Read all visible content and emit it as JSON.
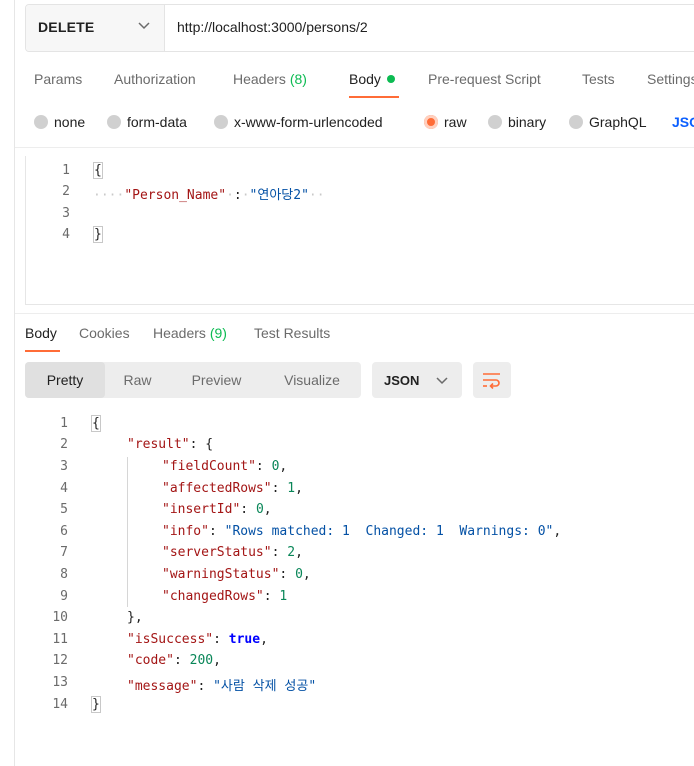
{
  "request": {
    "method": "DELETE",
    "url": "http://localhost:3000/persons/2"
  },
  "request_tabs": [
    {
      "label": "Params"
    },
    {
      "label": "Authorization"
    },
    {
      "label": "Headers",
      "count": "(8)"
    },
    {
      "label": "Body",
      "active": true
    },
    {
      "label": "Pre-request Script"
    },
    {
      "label": "Tests"
    },
    {
      "label": "Settings"
    }
  ],
  "body_types": [
    {
      "label": "none"
    },
    {
      "label": "form-data"
    },
    {
      "label": "x-www-form-urlencoded"
    },
    {
      "label": "raw",
      "selected": true
    },
    {
      "label": "binary"
    },
    {
      "label": "GraphQL"
    }
  ],
  "body_format": "JSON",
  "request_body": {
    "line_numbers": [
      "1",
      "2",
      "3",
      "4"
    ],
    "open_brace": "{",
    "key": "\"Person_Name\"",
    "colon": ":",
    "value": "\"연아당2\"",
    "close_brace": "}"
  },
  "response_tabs": [
    {
      "label": "Body",
      "active": true
    },
    {
      "label": "Cookies"
    },
    {
      "label": "Headers",
      "count": "(9)"
    },
    {
      "label": "Test Results"
    }
  ],
  "view_modes": [
    "Pretty",
    "Raw",
    "Preview",
    "Visualize"
  ],
  "response_format": "JSON",
  "response_body": {
    "line_numbers": [
      "1",
      "2",
      "3",
      "4",
      "5",
      "6",
      "7",
      "8",
      "9",
      "10",
      "11",
      "12",
      "13",
      "14"
    ],
    "open_brace": "{",
    "result_key": "\"result\"",
    "result_open": ": {",
    "fields": [
      {
        "key": "\"fieldCount\"",
        "value": "0",
        "type": "num",
        "sep": ","
      },
      {
        "key": "\"affectedRows\"",
        "value": "1",
        "type": "num",
        "sep": ","
      },
      {
        "key": "\"insertId\"",
        "value": "0",
        "type": "num",
        "sep": ","
      },
      {
        "key": "\"info\"",
        "value": "\"Rows matched: 1  Changed: 1  Warnings: 0\"",
        "type": "str",
        "sep": ","
      },
      {
        "key": "\"serverStatus\"",
        "value": "2",
        "type": "num",
        "sep": ","
      },
      {
        "key": "\"warningStatus\"",
        "value": "0",
        "type": "num",
        "sep": ","
      },
      {
        "key": "\"changedRows\"",
        "value": "1",
        "type": "num",
        "sep": ""
      }
    ],
    "result_close": "},",
    "top_fields": [
      {
        "key": "\"isSuccess\"",
        "value": "true",
        "type": "bool",
        "sep": ","
      },
      {
        "key": "\"code\"",
        "value": "200",
        "type": "num",
        "sep": ","
      },
      {
        "key": "\"message\"",
        "value": "\"사람 삭제 성공\"",
        "type": "str",
        "sep": ""
      }
    ],
    "close_brace": "}"
  },
  "colors": {
    "accent": "#ff6c37",
    "count_green": "#0cbb52",
    "json_key": "#a31515",
    "json_string": "#0451a5",
    "json_number": "#098658",
    "json_bool": "#0000ff"
  }
}
